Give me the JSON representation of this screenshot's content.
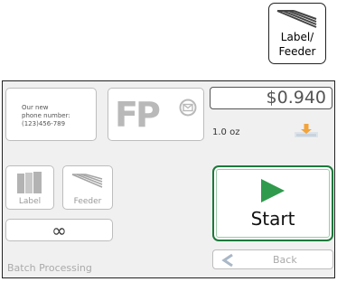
{
  "top_button": {
    "label_line1": "Label/",
    "label_line2": "Feeder",
    "icon": "stacked-envelopes-icon"
  },
  "info_card": {
    "line1": "Our new",
    "line2": "phone number:",
    "line3": "(123)456-789"
  },
  "logo": {
    "text": "FP",
    "icon": "envelope-badge-icon"
  },
  "postage": {
    "amount": "$0.940",
    "weight": "1.0 oz",
    "icon": "download-arrow-icon"
  },
  "modes": {
    "label": {
      "text": "Label",
      "icon": "label-sheets-icon"
    },
    "feeder": {
      "text": "Feeder",
      "icon": "feeder-stack-icon"
    }
  },
  "batch": {
    "count_symbol": "∞",
    "label": "Batch Processing"
  },
  "actions": {
    "start": "Start",
    "back": "Back"
  },
  "colors": {
    "accent_green": "#2f9a4c",
    "border_green": "#1b7a3a",
    "download_orange": "#f2a33a"
  }
}
